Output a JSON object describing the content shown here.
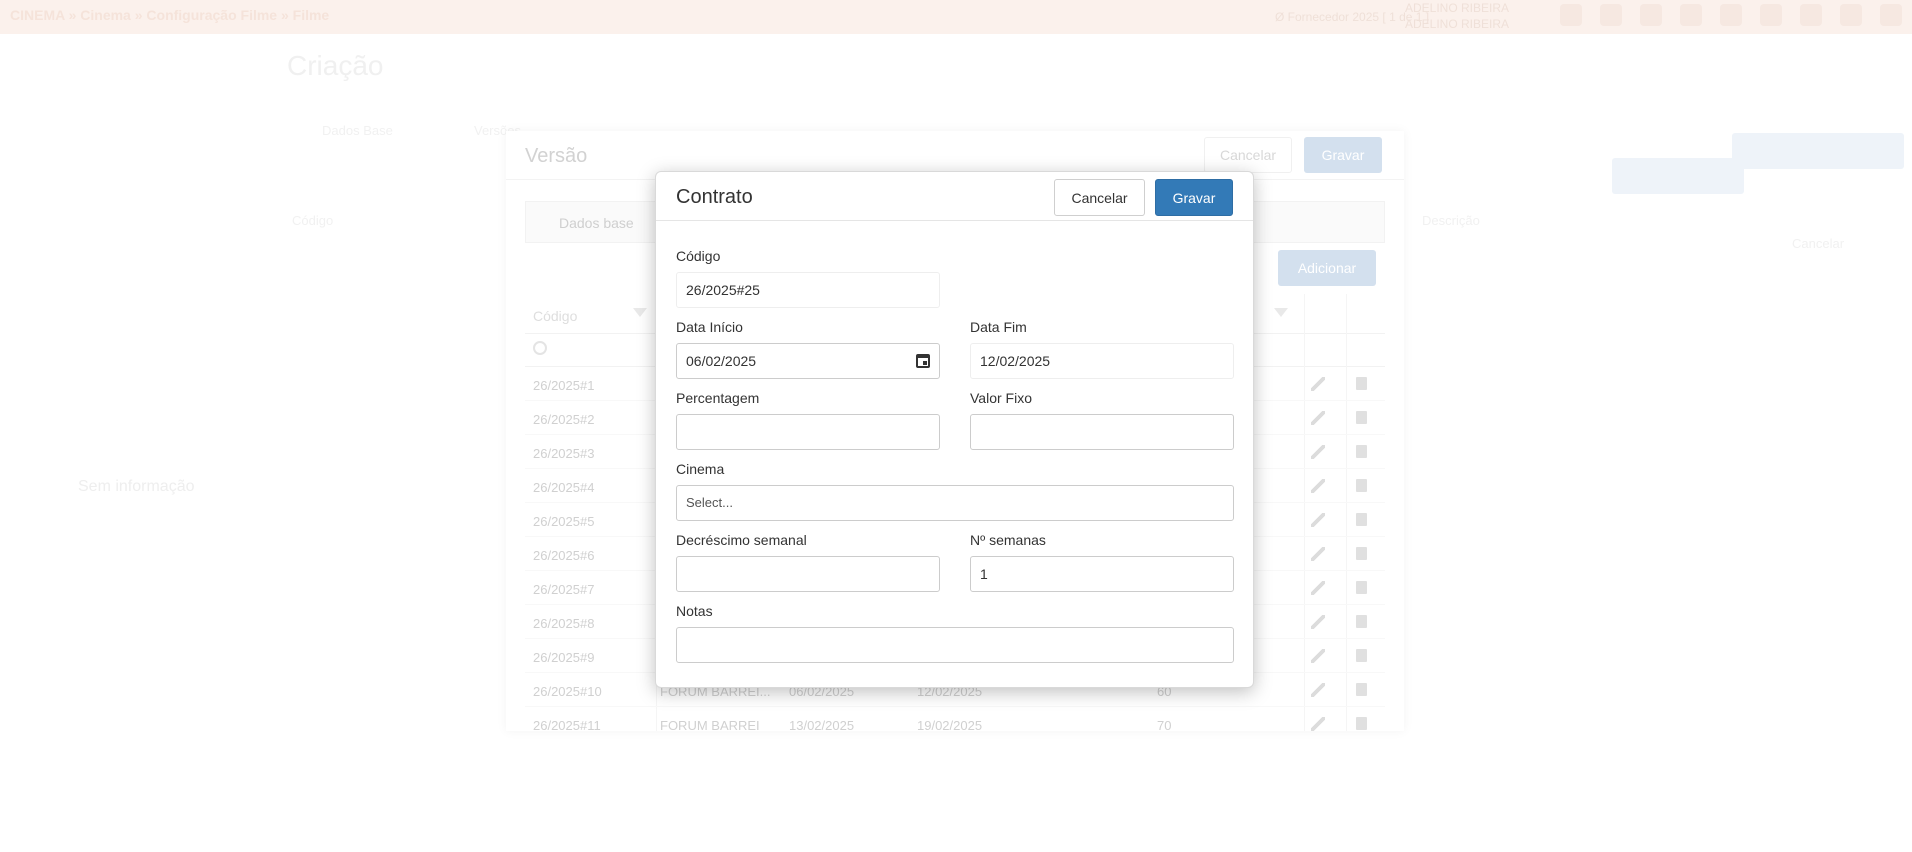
{
  "app": {
    "breadcrumb": "CINEMA » Cinema » Configuração Filme » Filme",
    "user_info": "Ø Fornecedor 2025 [ 1 de 1 ]",
    "user_name_line1": "ADELINO RIBEIRA",
    "user_name_line2": "ADELINO RIBEIRA",
    "page_title": "Criação",
    "tab_dados_base": "Dados Base",
    "tab_versoes": "Versões",
    "filter_left": "Código",
    "filter_right": "Descrição",
    "no_information": "Sem informação",
    "add_button": "Adicionar",
    "save_button": "Gravar",
    "cancel_button": "Cancelar"
  },
  "versao_modal": {
    "title": "Versão",
    "cancel_label": "Cancelar",
    "save_label": "Gravar",
    "tab_label": "Dados base",
    "add_label": "Adicionar",
    "column_code": "Código",
    "rows": [
      {
        "code": "26/2025#1"
      },
      {
        "code": "26/2025#2"
      },
      {
        "code": "26/2025#3"
      },
      {
        "code": "26/2025#4"
      },
      {
        "code": "26/2025#5"
      },
      {
        "code": "26/2025#6"
      },
      {
        "code": "26/2025#7"
      },
      {
        "code": "26/2025#8"
      },
      {
        "code": "26/2025#9"
      },
      {
        "code": "26/2025#10",
        "cinema": "FORUM BARREI...",
        "start": "06/02/2025",
        "end": "12/02/2025",
        "value": "60"
      },
      {
        "code": "26/2025#11",
        "cinema": "FORUM BARREI",
        "start": "13/02/2025",
        "end": "19/02/2025",
        "value": "70"
      }
    ]
  },
  "contrato_modal": {
    "title": "Contrato",
    "cancel_label": "Cancelar",
    "save_label": "Gravar",
    "fields": {
      "codigo_label": "Código",
      "codigo_value": "26/2025#25",
      "data_inicio_label": "Data Início",
      "data_inicio_value": "06/02/2025",
      "data_fim_label": "Data Fim",
      "data_fim_value": "12/02/2025",
      "percentagem_label": "Percentagem",
      "percentagem_value": "",
      "valor_fixo_label": "Valor Fixo",
      "valor_fixo_value": "",
      "cinema_label": "Cinema",
      "cinema_placeholder": "Select...",
      "decrescimo_label": "Decréscimo semanal",
      "decrescimo_value": "",
      "semanas_label": "Nº semanas",
      "semanas_value": "1",
      "notas_label": "Notas",
      "notas_value": ""
    }
  },
  "colors": {
    "primary": "#337ab7",
    "faded_primary": "#d3e0ee",
    "topbar": "#fbf1ec"
  }
}
